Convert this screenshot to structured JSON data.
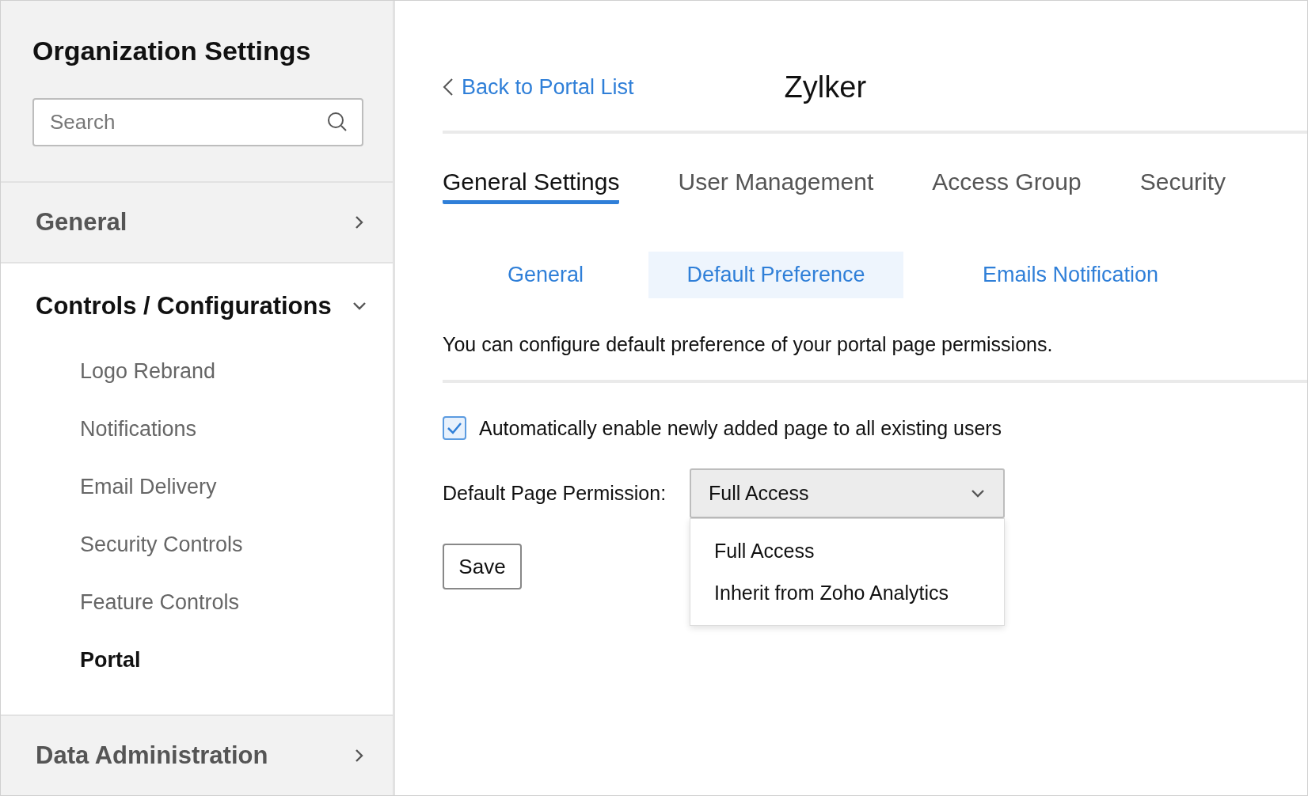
{
  "sidebar": {
    "title": "Organization Settings",
    "search": {
      "placeholder": "Search"
    },
    "sections": [
      {
        "label": "General",
        "expanded": false
      },
      {
        "label": "Controls / Configurations",
        "expanded": true,
        "items": [
          {
            "label": "Logo Rebrand",
            "selected": false
          },
          {
            "label": "Notifications",
            "selected": false
          },
          {
            "label": "Email Delivery",
            "selected": false
          },
          {
            "label": "Security Controls",
            "selected": false
          },
          {
            "label": "Feature Controls",
            "selected": false
          },
          {
            "label": "Portal",
            "selected": true
          }
        ]
      },
      {
        "label": "Data Administration",
        "expanded": false
      }
    ]
  },
  "header": {
    "back_link": "Back to Portal List",
    "portal_name": "Zylker"
  },
  "tabs": [
    {
      "label": "General Settings",
      "selected": true
    },
    {
      "label": "User Management",
      "selected": false
    },
    {
      "label": "Access Group",
      "selected": false
    },
    {
      "label": "Security",
      "selected": false
    }
  ],
  "subtabs": [
    {
      "label": "General",
      "selected": false
    },
    {
      "label": "Default Preference",
      "selected": true
    },
    {
      "label": "Emails Notification",
      "selected": false
    }
  ],
  "description": "You can configure default preference of your portal page permissions.",
  "checkbox": {
    "label": "Automatically enable newly added page to all existing users",
    "checked": true
  },
  "permission": {
    "label": "Default Page Permission:",
    "value": "Full Access",
    "expanded": true,
    "options": [
      "Full Access",
      "Inherit from Zoho Analytics"
    ]
  },
  "save_button": "Save"
}
